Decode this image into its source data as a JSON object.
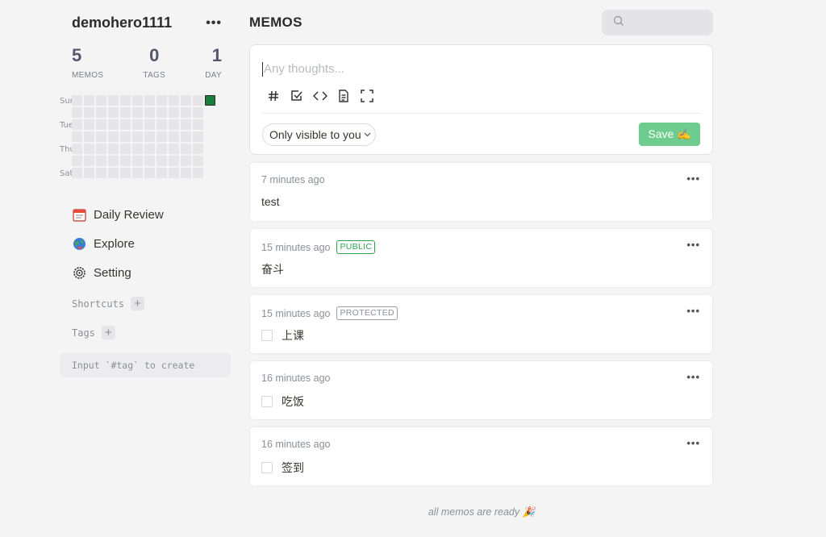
{
  "user": {
    "name": "demohero1111",
    "more_label": "•••"
  },
  "stats": [
    {
      "value": "5",
      "label": "MEMOS"
    },
    {
      "value": "0",
      "label": "TAGS"
    },
    {
      "value": "1",
      "label": "DAY"
    }
  ],
  "heatmap": {
    "day_labels": [
      "Sun",
      "Tue",
      "Thu",
      "Sat"
    ],
    "active_color": "#1a7f3b",
    "empty_color": "#e6e6e8"
  },
  "nav": [
    {
      "label": "Daily Review",
      "icon": "calendar-icon"
    },
    {
      "label": "Explore",
      "icon": "globe-icon"
    },
    {
      "label": "Setting",
      "icon": "gear-icon"
    }
  ],
  "sections": {
    "shortcuts": "Shortcuts",
    "tags": "Tags",
    "plus": "+"
  },
  "tag_hint": "Input `#tag` to create",
  "main": {
    "title": "MEMOS"
  },
  "search": {
    "placeholder": ""
  },
  "editor": {
    "placeholder": "Any thoughts...",
    "tools": [
      "hash-icon",
      "checkbox-icon",
      "code-icon",
      "file-icon",
      "fullscreen-icon"
    ],
    "visibility": "Only visible to you",
    "save_label": "Save ✍️"
  },
  "memos": [
    {
      "time": "7 minutes ago",
      "badge": "",
      "content": "test",
      "checkbox": false
    },
    {
      "time": "15 minutes ago",
      "badge": "PUBLIC",
      "content": "奋斗",
      "checkbox": false
    },
    {
      "time": "15 minutes ago",
      "badge": "PROTECTED",
      "content": "上课",
      "checkbox": true
    },
    {
      "time": "16 minutes ago",
      "badge": "",
      "content": "吃饭",
      "checkbox": true
    },
    {
      "time": "16 minutes ago",
      "badge": "",
      "content": "签到",
      "checkbox": true
    }
  ],
  "memo_more_label": "•••",
  "footer": {
    "text": "all memos are ready 🎉"
  },
  "colors": {
    "save_button": "#6dcc8e",
    "public_badge": "#2ea44f",
    "background": "#f4f4f5"
  }
}
